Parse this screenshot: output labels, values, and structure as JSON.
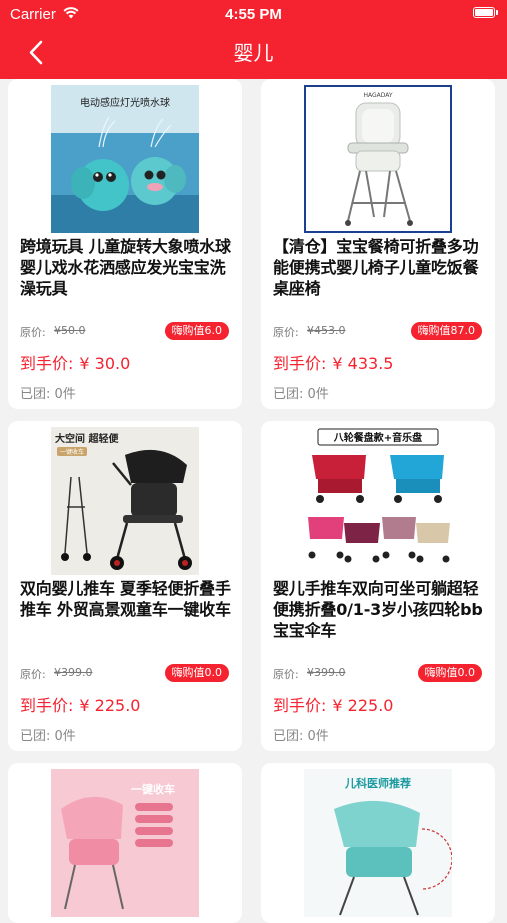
{
  "status_bar": {
    "carrier": "Carrier",
    "time": "4:55 PM"
  },
  "nav": {
    "title": "婴儿",
    "back_icon": "chevron-left-icon"
  },
  "colors": {
    "accent": "#f5232f"
  },
  "products": [
    {
      "image": "elephant-bath-toy-image",
      "image_caption": "电动感应灯光喷水球",
      "name": "跨境玩具 儿童旋转大象喷水球 婴儿戏水花洒感应发光宝宝洗澡玩具",
      "orig_label": "原价:",
      "orig_price": "¥50.0",
      "badge": "嗨购值6.0",
      "final_label": "到手价:",
      "final_price": "¥ 30.0",
      "groups": "已团: 0件"
    },
    {
      "image": "baby-high-chair-image",
      "image_caption": "HAGADAY",
      "name": "【清仓】宝宝餐椅可折叠多功能便携式婴儿椅子儿童吃饭餐桌座椅",
      "orig_label": "原价:",
      "orig_price": "¥453.0",
      "badge": "嗨购值87.0",
      "final_label": "到手价:",
      "final_price": "¥ 433.5",
      "groups": "已团: 0件"
    },
    {
      "image": "black-stroller-image",
      "image_caption": "大空间 超轻便",
      "image_sub": "一键收车",
      "name": "双向婴儿推车 夏季轻便折叠手推车 外贸高景观童车一键收车",
      "orig_label": "原价:",
      "orig_price": "¥399.0",
      "badge": "嗨购值0.0",
      "final_label": "到手价:",
      "final_price": "¥ 225.0",
      "groups": "已团: 0件"
    },
    {
      "image": "multicolor-strollers-image",
      "image_caption": "八轮餐盘款+音乐盘",
      "name": "婴儿手推车双向可坐可躺超轻便携折叠0/1-3岁小孩四轮bb宝宝伞车",
      "orig_label": "原价:",
      "orig_price": "¥399.0",
      "badge": "嗨购值0.0",
      "final_label": "到手价:",
      "final_price": "¥ 225.0",
      "groups": "已团: 0件"
    },
    {
      "image": "pink-stroller-image",
      "image_caption": "一键收车"
    },
    {
      "image": "teal-stroller-image",
      "image_caption": "儿科医师推荐"
    }
  ]
}
